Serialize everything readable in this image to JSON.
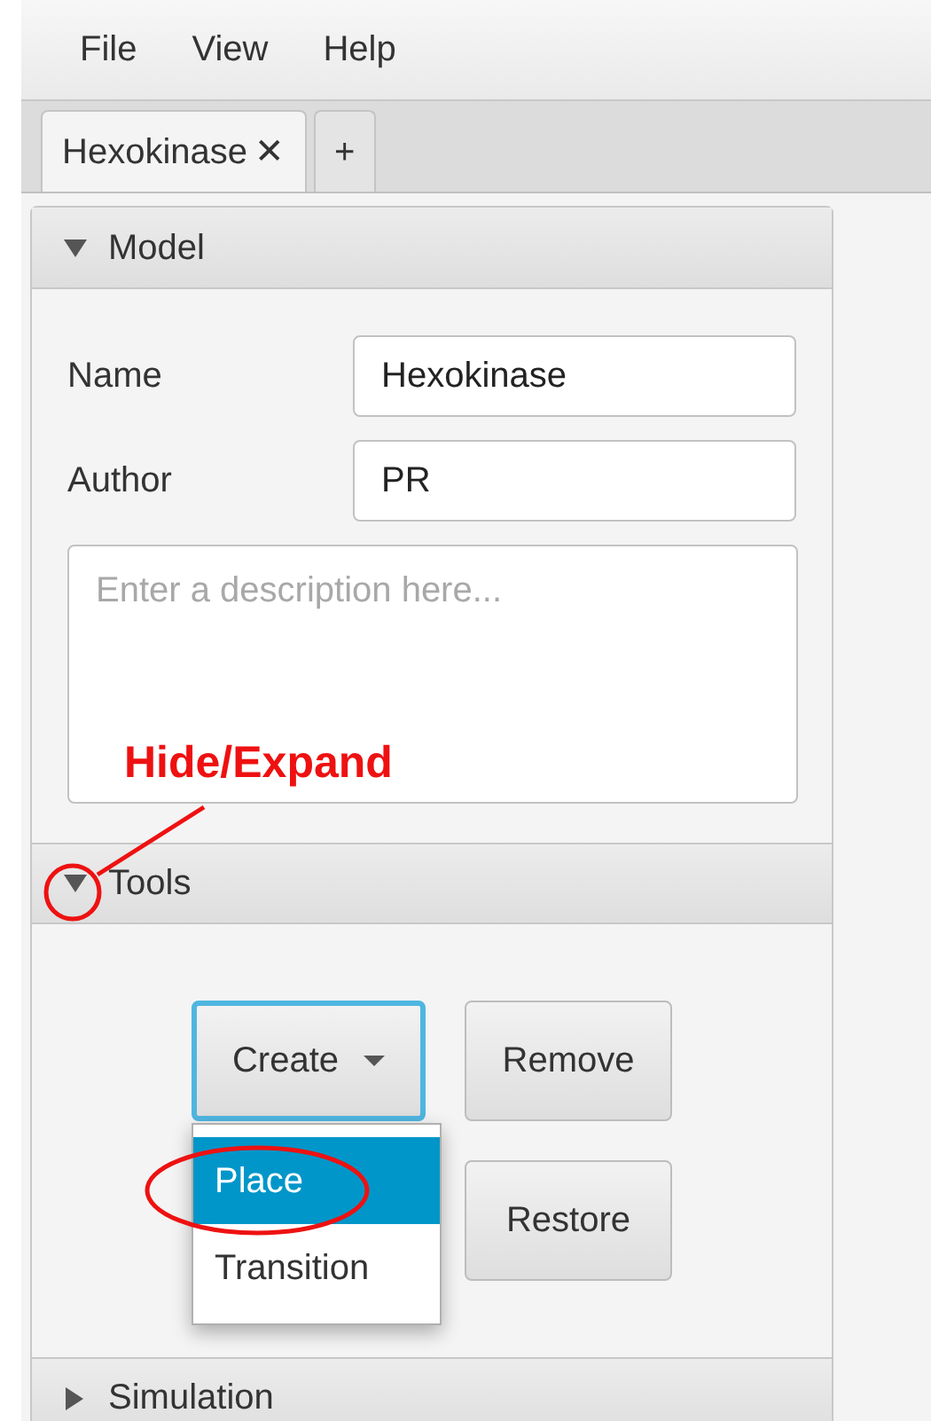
{
  "menu": [
    "File",
    "View",
    "Help"
  ],
  "tabs": [
    {
      "label": "Hexokinase",
      "close": "✕",
      "selected": true
    },
    {
      "label": "+",
      "selected": false
    }
  ],
  "sections": [
    {
      "kind": "model",
      "title": "Model",
      "expanded": true,
      "fields": [
        {
          "label": "Name",
          "value": "Hexokinase"
        },
        {
          "label": "Author",
          "value": "PR"
        }
      ],
      "description": {
        "placeholder": "Enter a description here..."
      }
    },
    {
      "kind": "tools",
      "title": "Tools",
      "expanded": true,
      "dropdown": {
        "label": "Create",
        "open": true,
        "items": [
          {
            "label": "Place",
            "selected": true
          },
          {
            "label": "Transition",
            "selected": false
          }
        ]
      },
      "buttons": [
        "Remove",
        "Restore"
      ]
    },
    {
      "title": "Simulation",
      "expanded": false
    }
  ],
  "annotation": {
    "text": "Hide/Expand"
  }
}
